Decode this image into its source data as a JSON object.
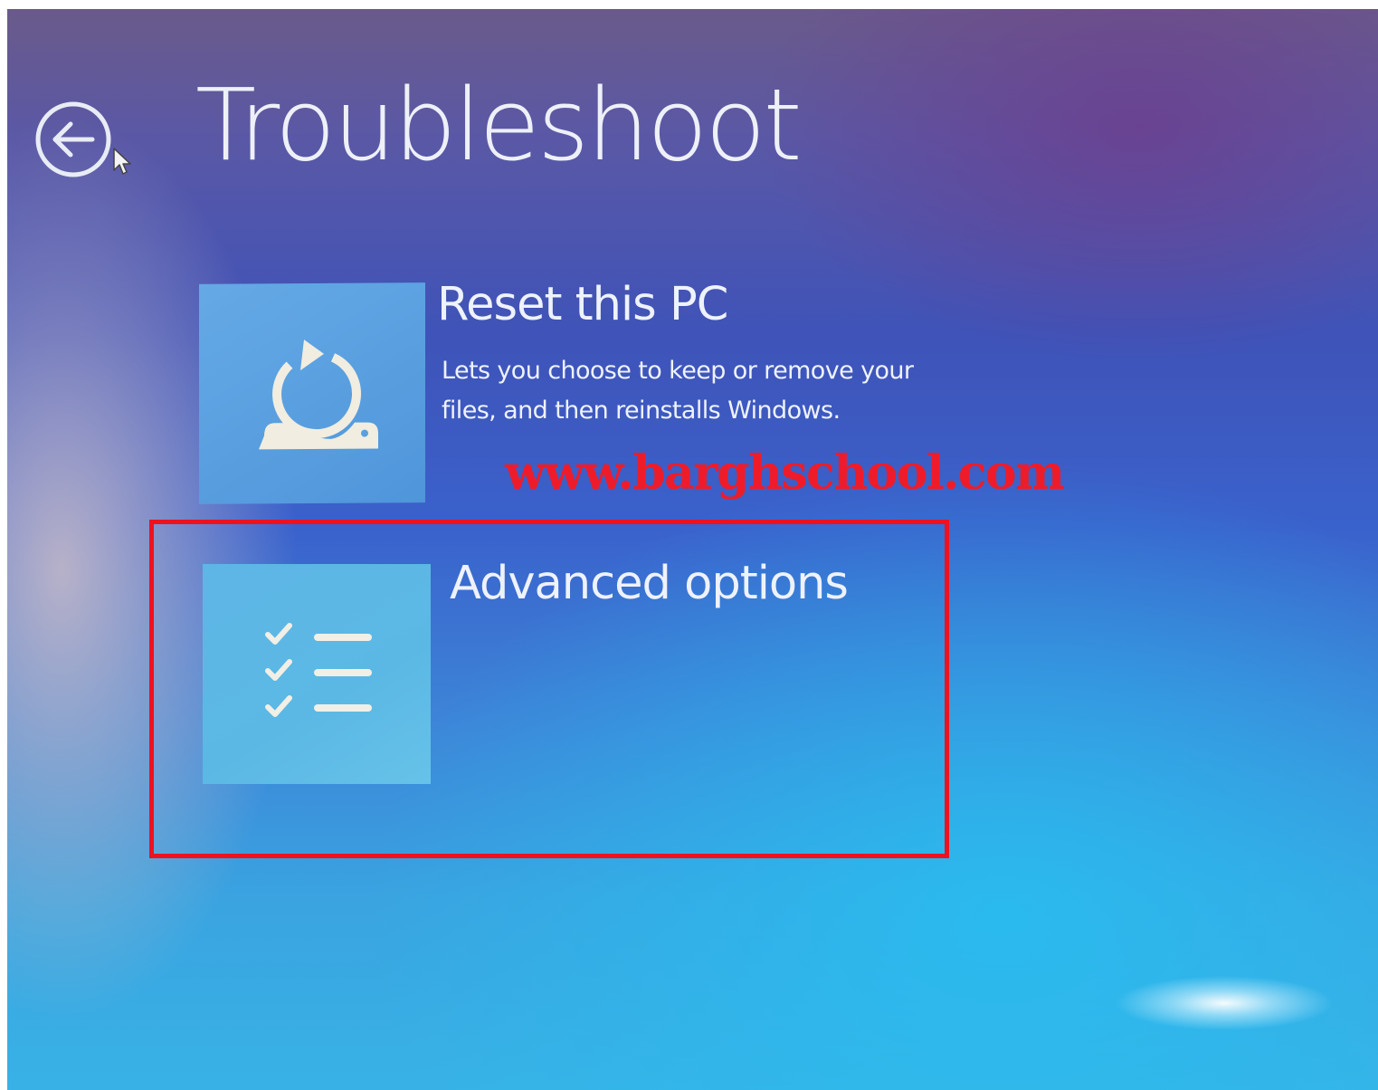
{
  "screen": {
    "title": "Troubleshoot",
    "back_icon": "back-arrow-circle-icon"
  },
  "options": [
    {
      "title": "Reset this PC",
      "description": "Lets you choose to keep or remove your files, and then reinstalls Windows.",
      "icon": "reset-pc-icon"
    },
    {
      "title": "Advanced options",
      "icon": "checklist-icon"
    }
  ],
  "overlay": {
    "watermark": "www.barghschool.com",
    "highlight_color": "#ee1120",
    "watermark_color": "#ee1c2a"
  },
  "colors": {
    "tile_reset": "#5aa0e0",
    "tile_advanced": "#5bb8e4",
    "text": "#eef2fb"
  }
}
